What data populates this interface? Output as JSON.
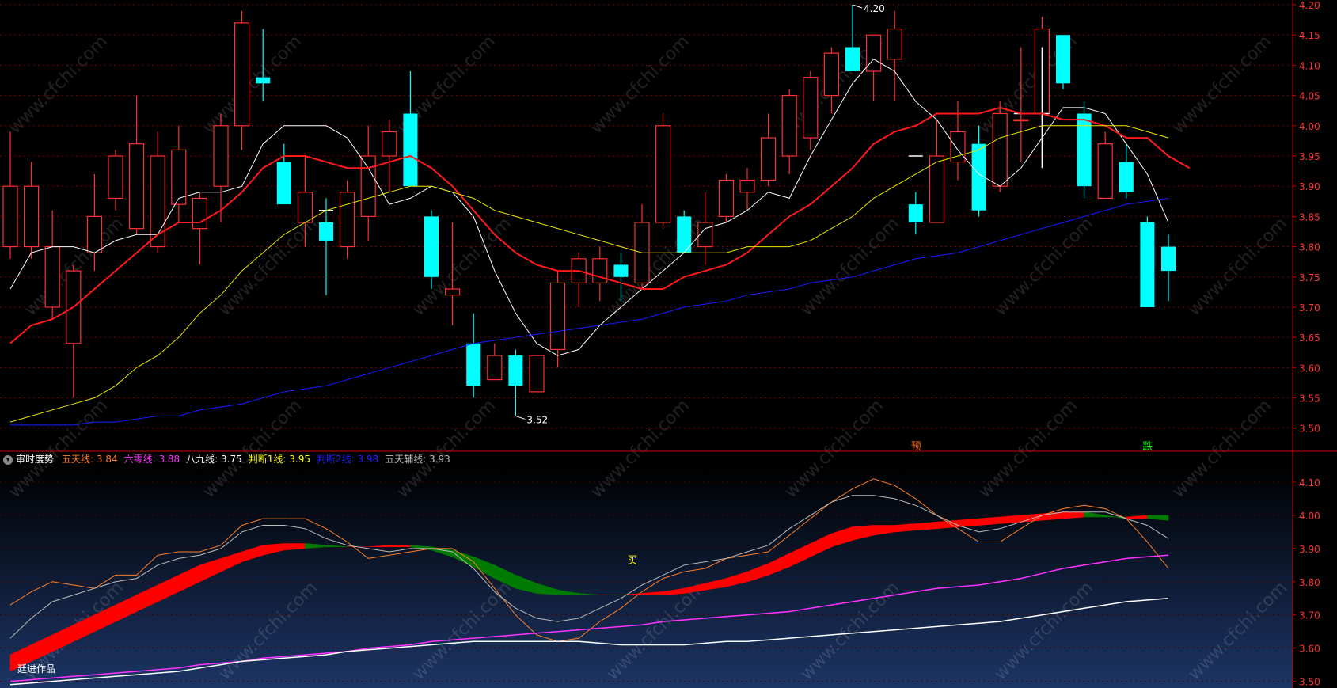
{
  "indicator_legend": {
    "title": "审时度势",
    "items": [
      {
        "label": "五天线: ",
        "value": "3.84",
        "color": "#ff7f27"
      },
      {
        "label": "六零线: ",
        "value": "3.88",
        "color": "#ff33ff"
      },
      {
        "label": "八九线: ",
        "value": "3.75",
        "color": "#ffffff"
      },
      {
        "label": "判断1线: ",
        "value": "3.95",
        "color": "#ffff00"
      },
      {
        "label": "判断2线: ",
        "value": "3.98",
        "color": "#2222ff"
      },
      {
        "label": "五天辅线: ",
        "value": "3.93",
        "color": "#bbbbbb"
      }
    ]
  },
  "credit": "廷进作品",
  "watermark": "www.cfchi.com",
  "colors": {
    "up": "#ff3030",
    "down": "#00ffff",
    "ma_white": "#ffffff",
    "ma_red": "#ff1a1a",
    "ma_yellow": "#e6e600",
    "ma_blue": "#1a1aff",
    "grid": "#7a0000",
    "axis": "#cc0000",
    "band_up": "#ff0000",
    "band_down": "#007a00"
  },
  "chart_data": [
    {
      "type": "candlestick",
      "ylim": [
        3.48,
        4.2
      ],
      "yticks": [
        "4.20",
        "4.15",
        "4.10",
        "4.05",
        "4.00",
        "3.95",
        "3.90",
        "3.85",
        "3.80",
        "3.75",
        "3.70",
        "3.65",
        "3.60",
        "3.55",
        "3.50"
      ],
      "candles": [
        {
          "o": 3.8,
          "h": 3.99,
          "l": 3.78,
          "c": 3.9
        },
        {
          "o": 3.8,
          "h": 3.94,
          "l": 3.78,
          "c": 3.9
        },
        {
          "o": 3.7,
          "h": 3.86,
          "l": 3.68,
          "c": 3.8
        },
        {
          "o": 3.64,
          "h": 3.77,
          "l": 3.55,
          "c": 3.76
        },
        {
          "o": 3.79,
          "h": 3.92,
          "l": 3.76,
          "c": 3.85
        },
        {
          "o": 3.88,
          "h": 3.96,
          "l": 3.86,
          "c": 3.95
        },
        {
          "o": 3.83,
          "h": 4.05,
          "l": 3.82,
          "c": 3.97
        },
        {
          "o": 3.8,
          "h": 3.99,
          "l": 3.79,
          "c": 3.95
        },
        {
          "o": 3.87,
          "h": 4.0,
          "l": 3.84,
          "c": 3.96
        },
        {
          "o": 3.83,
          "h": 3.89,
          "l": 3.77,
          "c": 3.88
        },
        {
          "o": 3.9,
          "h": 4.02,
          "l": 3.84,
          "c": 4.0
        },
        {
          "o": 4.0,
          "h": 4.19,
          "l": 3.96,
          "c": 4.17
        },
        {
          "o": 4.08,
          "h": 4.16,
          "l": 4.04,
          "c": 4.07
        },
        {
          "o": 3.94,
          "h": 3.97,
          "l": 3.87,
          "c": 3.87
        },
        {
          "o": 3.84,
          "h": 3.95,
          "l": 3.8,
          "c": 3.89
        },
        {
          "o": 3.84,
          "h": 3.88,
          "l": 3.72,
          "c": 3.81
        },
        {
          "o": 3.8,
          "h": 3.91,
          "l": 3.78,
          "c": 3.89
        },
        {
          "o": 3.85,
          "h": 4.0,
          "l": 3.81,
          "c": 3.95
        },
        {
          "o": 3.95,
          "h": 4.01,
          "l": 3.89,
          "c": 3.99
        },
        {
          "o": 4.02,
          "h": 4.09,
          "l": 3.9,
          "c": 3.9
        },
        {
          "o": 3.85,
          "h": 3.86,
          "l": 3.73,
          "c": 3.75
        },
        {
          "o": 3.72,
          "h": 3.84,
          "l": 3.67,
          "c": 3.73
        },
        {
          "o": 3.64,
          "h": 3.69,
          "l": 3.55,
          "c": 3.57
        },
        {
          "o": 3.58,
          "h": 3.64,
          "l": 3.58,
          "c": 3.62
        },
        {
          "o": 3.62,
          "h": 3.63,
          "l": 3.52,
          "c": 3.57
        },
        {
          "o": 3.56,
          "h": 3.62,
          "l": 3.56,
          "c": 3.62
        },
        {
          "o": 3.63,
          "h": 3.76,
          "l": 3.6,
          "c": 3.74
        },
        {
          "o": 3.74,
          "h": 3.79,
          "l": 3.7,
          "c": 3.78
        },
        {
          "o": 3.74,
          "h": 3.8,
          "l": 3.71,
          "c": 3.78
        },
        {
          "o": 3.77,
          "h": 3.79,
          "l": 3.71,
          "c": 3.75
        },
        {
          "o": 3.74,
          "h": 3.87,
          "l": 3.73,
          "c": 3.84
        },
        {
          "o": 3.84,
          "h": 4.02,
          "l": 3.83,
          "c": 4.0
        },
        {
          "o": 3.85,
          "h": 3.86,
          "l": 3.79,
          "c": 3.79
        },
        {
          "o": 3.8,
          "h": 3.89,
          "l": 3.77,
          "c": 3.84
        },
        {
          "o": 3.85,
          "h": 3.92,
          "l": 3.84,
          "c": 3.91
        },
        {
          "o": 3.89,
          "h": 3.93,
          "l": 3.86,
          "c": 3.91
        },
        {
          "o": 3.91,
          "h": 4.02,
          "l": 3.9,
          "c": 3.98
        },
        {
          "o": 3.95,
          "h": 4.06,
          "l": 3.92,
          "c": 4.05
        },
        {
          "o": 3.98,
          "h": 4.09,
          "l": 3.96,
          "c": 4.08
        },
        {
          "o": 4.05,
          "h": 4.13,
          "l": 4.02,
          "c": 4.12
        },
        {
          "o": 4.13,
          "h": 4.2,
          "l": 4.1,
          "c": 4.09
        },
        {
          "o": 4.09,
          "h": 4.15,
          "l": 4.04,
          "c": 4.15
        },
        {
          "o": 4.11,
          "h": 4.19,
          "l": 4.04,
          "c": 4.16
        },
        {
          "o": 3.87,
          "h": 3.89,
          "l": 3.82,
          "c": 3.84
        },
        {
          "o": 3.84,
          "h": 4.01,
          "l": 3.84,
          "c": 3.95
        },
        {
          "o": 3.94,
          "h": 4.04,
          "l": 3.91,
          "c": 3.99
        },
        {
          "o": 3.97,
          "h": 4.0,
          "l": 3.85,
          "c": 3.86
        },
        {
          "o": 3.9,
          "h": 4.04,
          "l": 3.89,
          "c": 4.02
        },
        {
          "o": 4.01,
          "h": 4.13,
          "l": 3.94,
          "c": 4.01
        },
        {
          "o": 4.02,
          "h": 4.18,
          "l": 4.01,
          "c": 4.16
        },
        {
          "o": 4.15,
          "h": 4.15,
          "l": 4.06,
          "c": 4.07
        },
        {
          "o": 4.02,
          "h": 4.04,
          "l": 3.88,
          "c": 3.9
        },
        {
          "o": 3.88,
          "h": 3.99,
          "l": 3.88,
          "c": 3.97
        },
        {
          "o": 3.94,
          "h": 3.97,
          "l": 3.88,
          "c": 3.89
        },
        {
          "o": 3.84,
          "h": 3.85,
          "l": 3.7,
          "c": 3.7
        },
        {
          "o": 3.8,
          "h": 3.82,
          "l": 3.71,
          "c": 3.76
        }
      ],
      "dashes": [
        {
          "i": 15,
          "y": 3.86
        },
        {
          "i": 43,
          "y": 3.95
        },
        {
          "i": 48,
          "y": 4.02
        }
      ],
      "crosses": [
        {
          "i": 49,
          "ylo": 3.93,
          "yhi": 4.13,
          "y": 4.02
        }
      ],
      "ma": [
        {
          "color": "#ffffff",
          "width": 1,
          "values": [
            3.73,
            3.79,
            3.8,
            3.8,
            3.79,
            3.81,
            3.82,
            3.82,
            3.88,
            3.89,
            3.89,
            3.9,
            3.97,
            4.0,
            4.0,
            4.0,
            3.98,
            3.93,
            3.87,
            3.88,
            3.9,
            3.89,
            3.85,
            3.76,
            3.69,
            3.64,
            3.62,
            3.63,
            3.67,
            3.7,
            3.73,
            3.76,
            3.79,
            3.83,
            3.84,
            3.86,
            3.89,
            3.88,
            3.95,
            4.01,
            4.07,
            4.11,
            4.09,
            4.04,
            4.01,
            3.96,
            3.92,
            3.9,
            3.93,
            3.98,
            4.03,
            4.03,
            4.02,
            3.97,
            3.92,
            3.84
          ]
        },
        {
          "color": "#ff1a1a",
          "width": 2,
          "values": [
            3.64,
            3.67,
            3.68,
            3.7,
            3.73,
            3.76,
            3.79,
            3.82,
            3.84,
            3.84,
            3.86,
            3.89,
            3.93,
            3.95,
            3.95,
            3.94,
            3.93,
            3.93,
            3.94,
            3.95,
            3.93,
            3.9,
            3.86,
            3.82,
            3.79,
            3.77,
            3.76,
            3.76,
            3.75,
            3.74,
            3.73,
            3.73,
            3.75,
            3.76,
            3.77,
            3.79,
            3.82,
            3.85,
            3.87,
            3.9,
            3.93,
            3.97,
            3.99,
            4.0,
            4.02,
            4.02,
            4.02,
            4.03,
            4.02,
            4.02,
            4.01,
            4.01,
            4.0,
            3.98,
            3.98,
            3.95,
            3.93
          ]
        },
        {
          "color": "#e6e600",
          "width": 1,
          "values": [
            3.51,
            3.52,
            3.53,
            3.54,
            3.55,
            3.57,
            3.6,
            3.62,
            3.65,
            3.69,
            3.72,
            3.76,
            3.79,
            3.82,
            3.84,
            3.86,
            3.87,
            3.88,
            3.89,
            3.9,
            3.9,
            3.89,
            3.88,
            3.86,
            3.85,
            3.84,
            3.83,
            3.82,
            3.81,
            3.8,
            3.79,
            3.79,
            3.79,
            3.79,
            3.79,
            3.8,
            3.8,
            3.8,
            3.81,
            3.83,
            3.85,
            3.88,
            3.9,
            3.92,
            3.94,
            3.95,
            3.96,
            3.98,
            3.99,
            4.0,
            4.0,
            4.0,
            4.0,
            4.0,
            3.99,
            3.98
          ]
        },
        {
          "color": "#1a1aff",
          "width": 1,
          "values": [
            3.505,
            3.505,
            3.505,
            3.505,
            3.51,
            3.51,
            3.515,
            3.52,
            3.52,
            3.53,
            3.535,
            3.54,
            3.55,
            3.56,
            3.565,
            3.57,
            3.58,
            3.59,
            3.6,
            3.61,
            3.62,
            3.63,
            3.64,
            3.645,
            3.65,
            3.655,
            3.66,
            3.665,
            3.67,
            3.675,
            3.68,
            3.69,
            3.7,
            3.705,
            3.71,
            3.72,
            3.725,
            3.73,
            3.74,
            3.745,
            3.75,
            3.76,
            3.77,
            3.78,
            3.785,
            3.79,
            3.8,
            3.81,
            3.82,
            3.83,
            3.84,
            3.85,
            3.86,
            3.87,
            3.875,
            3.88
          ]
        }
      ],
      "annotations": [
        {
          "i": 40,
          "y": 4.2,
          "text": "4.20"
        },
        {
          "i": 24,
          "y": 3.52,
          "text": "3.52"
        }
      ],
      "signals": [
        {
          "i": 43,
          "text": "预",
          "color": "#ff6600"
        },
        {
          "i": 54,
          "text": "跌",
          "color": "#00ff00"
        }
      ]
    },
    {
      "type": "line",
      "title": "审时度势",
      "ylim": [
        3.48,
        4.15
      ],
      "yticks": [
        "4.10",
        "4.00",
        "3.90",
        "3.80",
        "3.70",
        "3.60",
        "3.50"
      ],
      "series": [
        {
          "name": "五天线",
          "color": "#ff7f27",
          "width": 1,
          "values": [
            3.73,
            3.77,
            3.8,
            3.79,
            3.78,
            3.82,
            3.82,
            3.88,
            3.89,
            3.89,
            3.91,
            3.97,
            3.99,
            3.99,
            3.99,
            3.96,
            3.92,
            3.87,
            3.88,
            3.89,
            3.9,
            3.9,
            3.86,
            3.78,
            3.7,
            3.64,
            3.62,
            3.63,
            3.68,
            3.72,
            3.77,
            3.81,
            3.83,
            3.84,
            3.87,
            3.88,
            3.89,
            3.94,
            3.99,
            4.04,
            4.08,
            4.11,
            4.09,
            4.05,
            4.0,
            3.96,
            3.92,
            3.92,
            3.96,
            4.0,
            4.02,
            4.03,
            4.02,
            3.99,
            3.92,
            3.84
          ]
        },
        {
          "name": "五天辅线",
          "color": "#bbbbbb",
          "width": 1,
          "values": [
            3.63,
            3.69,
            3.74,
            3.76,
            3.78,
            3.8,
            3.81,
            3.85,
            3.87,
            3.88,
            3.9,
            3.95,
            3.97,
            3.97,
            3.96,
            3.93,
            3.91,
            3.9,
            3.89,
            3.9,
            3.9,
            3.89,
            3.84,
            3.77,
            3.72,
            3.69,
            3.68,
            3.69,
            3.72,
            3.75,
            3.79,
            3.82,
            3.85,
            3.86,
            3.87,
            3.89,
            3.91,
            3.96,
            4.0,
            4.04,
            4.06,
            4.06,
            4.05,
            4.03,
            4.0,
            3.97,
            3.95,
            3.96,
            3.98,
            4.0,
            4.01,
            4.01,
            4.01,
            3.99,
            3.97,
            3.93
          ]
        },
        {
          "name": "六零线",
          "color": "#ff33ff",
          "width": 1.5,
          "values": [
            3.5,
            3.505,
            3.51,
            3.515,
            3.52,
            3.525,
            3.53,
            3.535,
            3.54,
            3.55,
            3.555,
            3.56,
            3.57,
            3.575,
            3.58,
            3.585,
            3.59,
            3.6,
            3.605,
            3.61,
            3.62,
            3.625,
            3.63,
            3.635,
            3.64,
            3.645,
            3.65,
            3.655,
            3.66,
            3.665,
            3.67,
            3.68,
            3.685,
            3.69,
            3.695,
            3.7,
            3.705,
            3.71,
            3.72,
            3.73,
            3.74,
            3.75,
            3.76,
            3.77,
            3.78,
            3.785,
            3.79,
            3.8,
            3.81,
            3.825,
            3.84,
            3.85,
            3.86,
            3.87,
            3.875,
            3.88
          ]
        },
        {
          "name": "八九线",
          "color": "#ffffff",
          "width": 1.5,
          "values": [
            3.49,
            3.495,
            3.5,
            3.505,
            3.51,
            3.515,
            3.52,
            3.525,
            3.53,
            3.54,
            3.55,
            3.56,
            3.565,
            3.57,
            3.575,
            3.58,
            3.59,
            3.595,
            3.6,
            3.605,
            3.61,
            3.615,
            3.62,
            3.62,
            3.62,
            3.62,
            3.62,
            3.62,
            3.615,
            3.61,
            3.61,
            3.61,
            3.61,
            3.615,
            3.62,
            3.62,
            3.625,
            3.63,
            3.635,
            3.64,
            3.645,
            3.65,
            3.655,
            3.66,
            3.665,
            3.67,
            3.675,
            3.68,
            3.69,
            3.7,
            3.71,
            3.72,
            3.73,
            3.74,
            3.745,
            3.75
          ]
        }
      ],
      "band": {
        "upper": [
          3.58,
          3.61,
          3.64,
          3.67,
          3.7,
          3.73,
          3.76,
          3.79,
          3.82,
          3.85,
          3.87,
          3.89,
          3.91,
          3.915,
          3.915,
          3.91,
          3.905,
          3.905,
          3.91,
          3.91,
          3.905,
          3.895,
          3.875,
          3.85,
          3.82,
          3.795,
          3.775,
          3.765,
          3.76,
          3.76,
          3.765,
          3.77,
          3.78,
          3.795,
          3.81,
          3.83,
          3.855,
          3.885,
          3.915,
          3.945,
          3.965,
          3.97,
          3.97,
          3.975,
          3.98,
          3.985,
          3.99,
          3.995,
          4.0,
          4.005,
          4.01,
          4.01,
          4.0,
          3.99,
          3.99,
          3.985
        ],
        "lower": [
          3.53,
          3.56,
          3.59,
          3.62,
          3.65,
          3.68,
          3.71,
          3.74,
          3.77,
          3.8,
          3.83,
          3.86,
          3.88,
          3.895,
          3.9,
          3.905,
          3.905,
          3.905,
          3.905,
          3.905,
          3.895,
          3.875,
          3.845,
          3.81,
          3.78,
          3.765,
          3.76,
          3.76,
          3.76,
          3.76,
          3.76,
          3.76,
          3.765,
          3.775,
          3.785,
          3.8,
          3.82,
          3.845,
          3.875,
          3.905,
          3.925,
          3.94,
          3.95,
          3.955,
          3.96,
          3.965,
          3.97,
          3.975,
          3.98,
          3.985,
          3.99,
          3.995,
          3.995,
          3.995,
          4.0,
          4.0
        ],
        "up_color": "#ff0000",
        "down_color": "#007a00"
      },
      "signals": [
        {
          "i": 29,
          "y": 3.84,
          "text": "买",
          "color": "#ffff00"
        }
      ]
    }
  ]
}
